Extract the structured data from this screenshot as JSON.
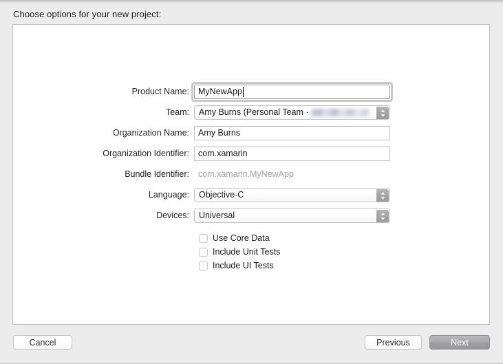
{
  "dialog": {
    "title": "Choose options for your new project:"
  },
  "form": {
    "fields": [
      {
        "label": "Product Name:",
        "type": "text",
        "value": "MyNewApp",
        "placeholder": "",
        "focused": true,
        "name": "product-name"
      },
      {
        "label": "Team:",
        "type": "popup",
        "value": "Amy Burns (Personal Team ·",
        "redacted": true,
        "name": "team"
      },
      {
        "label": "Organization Name:",
        "type": "text",
        "value": "Amy Burns",
        "placeholder": "",
        "focused": false,
        "name": "organization-name"
      },
      {
        "label": "Organization Identifier:",
        "type": "text",
        "value": "com.xamarin",
        "placeholder": "",
        "focused": false,
        "name": "organization-identifier"
      },
      {
        "label": "Bundle Identifier:",
        "type": "static",
        "value": "com.xamarin.MyNewApp",
        "name": "bundle-identifier"
      },
      {
        "label": "Language:",
        "type": "popup",
        "value": "Objective-C",
        "redacted": false,
        "name": "language"
      },
      {
        "label": "Devices:",
        "type": "popup",
        "value": "Universal",
        "redacted": false,
        "name": "devices"
      }
    ],
    "checkboxes": [
      {
        "label": "Use Core Data",
        "checked": false,
        "name": "use-core-data"
      },
      {
        "label": "Include Unit Tests",
        "checked": false,
        "name": "include-unit-tests"
      },
      {
        "label": "Include UI Tests",
        "checked": false,
        "name": "include-ui-tests"
      }
    ]
  },
  "buttons": {
    "cancel": "Cancel",
    "previous": "Previous",
    "next": "Next"
  },
  "colors": {
    "window_background": "#ececec",
    "panel_background": "#ffffff",
    "panel_border": "#bfbfbf",
    "text": "#1d1d1d",
    "disabled_text": "#a0a0a0",
    "focus_ring": "#c8c8c8",
    "default_button": "#a5a5aa"
  }
}
